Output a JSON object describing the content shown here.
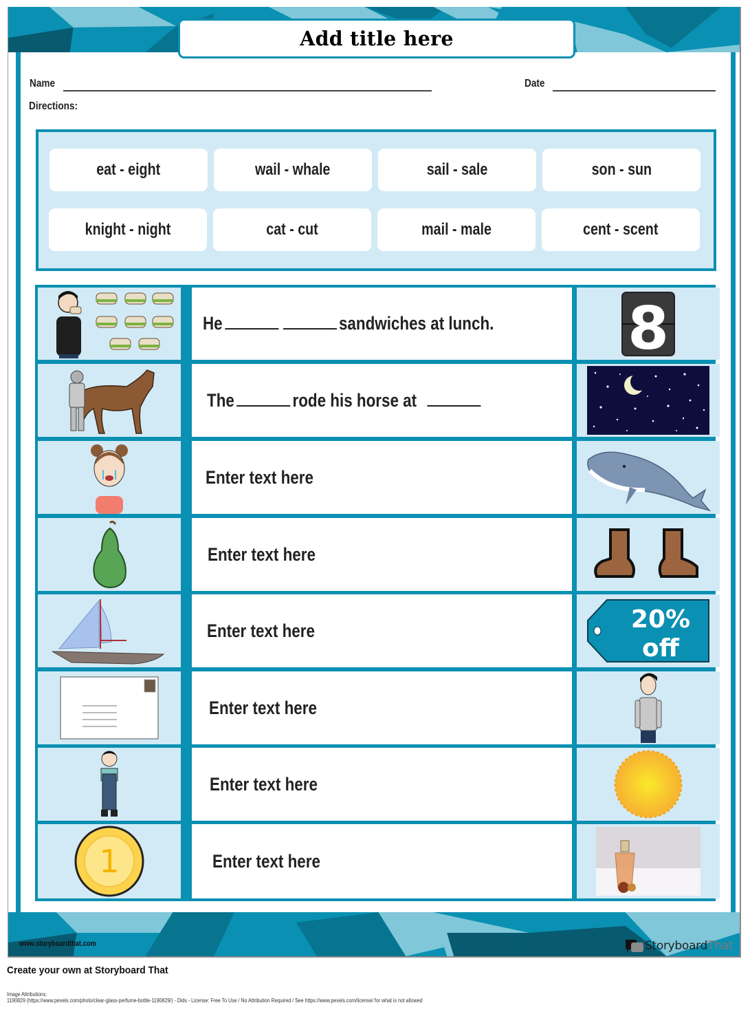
{
  "worksheet": {
    "title": "Add title here",
    "name_label": "Name",
    "date_label": "Date",
    "directions_label": "Directions:"
  },
  "word_bank": [
    "eat - eight",
    "wail - whale",
    "sail - sale",
    "son - sun",
    "knight - night",
    "cat - cut",
    "mail - male",
    "cent - scent"
  ],
  "rows": [
    {
      "left_image": "boy-eating-sandwiches",
      "sentence_parts": [
        "He",
        "",
        "",
        "sandwiches at lunch."
      ],
      "right_image": "number-eight-flip-card"
    },
    {
      "left_image": "knight-with-horse",
      "sentence_parts": [
        "The",
        "",
        "rode his horse at",
        ""
      ],
      "right_image": "night-sky-moon"
    },
    {
      "left_image": "crying-girl",
      "text": "Enter text here",
      "right_image": "whale"
    },
    {
      "left_image": "pear",
      "text": "Enter text here",
      "right_image": "boots"
    },
    {
      "left_image": "sailboat",
      "text": "Enter text here",
      "right_image": "sale-tag"
    },
    {
      "left_image": "envelope-mail",
      "text": "Enter text here",
      "right_image": "man-standing"
    },
    {
      "left_image": "boy-in-overalls",
      "text": "Enter text here",
      "right_image": "sun"
    },
    {
      "left_image": "gold-coin-one-cent",
      "text": "Enter text here",
      "right_image": "perfume-bottle-photo"
    }
  ],
  "sale_tag": {
    "line1": "20%",
    "line2": "off"
  },
  "coin_value": "1",
  "flip_digit": "8",
  "footer": {
    "url": "www.storyboardthat.com",
    "brand_storyboard": "Storyboard",
    "brand_that": "That",
    "create_text": "Create your own at Storyboard That",
    "attribution_heading": "Image Attributions:",
    "attribution_line": "1190829 (https://www.pexels.com/photo/clear-glass-perfume-bottle-1190829/) - Dids - License: Free To Use / No Attribution Required / See https://www.pexels.com/license/ for what is not allowed"
  },
  "colors": {
    "teal": "#0a90b2",
    "light_blue": "#d2eaf5",
    "text": "#222222"
  }
}
